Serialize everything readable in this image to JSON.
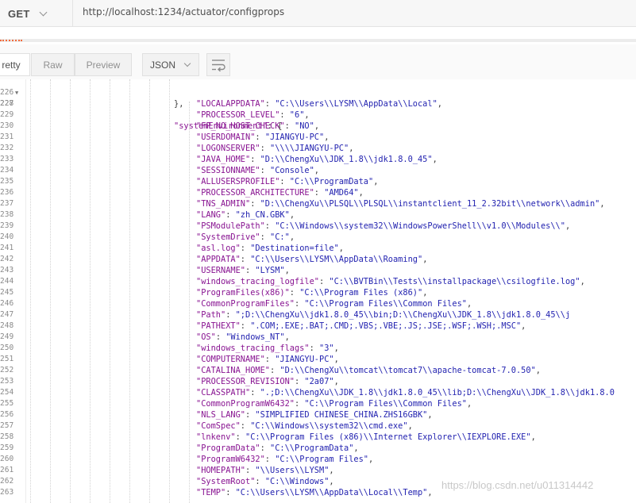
{
  "request": {
    "method": "GET",
    "url": "http://localhost:1234/actuator/configprops"
  },
  "toolbar": {
    "tabs": [
      "retty",
      "Raw",
      "Preview"
    ],
    "format": "JSON",
    "wrap_icon": "wrap-lines-icon"
  },
  "code": {
    "first_line": {
      "number": "226",
      "text": "},"
    },
    "open_line": {
      "number": "227",
      "key": "\"systemEnvironment\"",
      "rest": ": {"
    },
    "entries": [
      {
        "n": "228",
        "key": "\"LOCALAPPDATA\"",
        "value": "\"C:\\\\Users\\\\LYSM\\\\AppData\\\\Local\"",
        "comma": ","
      },
      {
        "n": "229",
        "key": "\"PROCESSOR_LEVEL\"",
        "value": "\"6\"",
        "comma": ","
      },
      {
        "n": "230",
        "key": "\"FP_NO_HOST_CHECK\"",
        "value": "\"NO\"",
        "comma": ","
      },
      {
        "n": "231",
        "key": "\"USERDOMAIN\"",
        "value": "\"JIANGYU-PC\"",
        "comma": ","
      },
      {
        "n": "232",
        "key": "\"LOGONSERVER\"",
        "value": "\"\\\\\\\\JIANGYU-PC\"",
        "comma": ","
      },
      {
        "n": "233",
        "key": "\"JAVA_HOME\"",
        "value": "\"D:\\\\ChengXu\\\\JDK_1.8\\\\jdk1.8.0_45\"",
        "comma": ","
      },
      {
        "n": "234",
        "key": "\"SESSIONNAME\"",
        "value": "\"Console\"",
        "comma": ","
      },
      {
        "n": "235",
        "key": "\"ALLUSERSPROFILE\"",
        "value": "\"C:\\\\ProgramData\"",
        "comma": ","
      },
      {
        "n": "236",
        "key": "\"PROCESSOR_ARCHITECTURE\"",
        "value": "\"AMD64\"",
        "comma": ","
      },
      {
        "n": "237",
        "key": "\"TNS_ADMIN\"",
        "value": "\"D:\\\\ChengXu\\\\PLSQL\\\\PLSQL\\\\instantclient_11_2.32bit\\\\network\\\\admin\"",
        "comma": ","
      },
      {
        "n": "238",
        "key": "\"LANG\"",
        "value": "\"zh_CN.GBK\"",
        "comma": ","
      },
      {
        "n": "239",
        "key": "\"PSModulePath\"",
        "value": "\"C:\\\\Windows\\\\system32\\\\WindowsPowerShell\\\\v1.0\\\\Modules\\\\\"",
        "comma": ","
      },
      {
        "n": "240",
        "key": "\"SystemDrive\"",
        "value": "\"C:\"",
        "comma": ","
      },
      {
        "n": "241",
        "key": "\"asl.log\"",
        "value": "\"Destination=file\"",
        "comma": ","
      },
      {
        "n": "242",
        "key": "\"APPDATA\"",
        "value": "\"C:\\\\Users\\\\LYSM\\\\AppData\\\\Roaming\"",
        "comma": ","
      },
      {
        "n": "243",
        "key": "\"USERNAME\"",
        "value": "\"LYSM\"",
        "comma": ","
      },
      {
        "n": "244",
        "key": "\"windows_tracing_logfile\"",
        "value": "\"C:\\\\BVTBin\\\\Tests\\\\installpackage\\\\csilogfile.log\"",
        "comma": ","
      },
      {
        "n": "245",
        "key": "\"ProgramFiles(x86)\"",
        "value": "\"C:\\\\Program Files (x86)\"",
        "comma": ","
      },
      {
        "n": "246",
        "key": "\"CommonProgramFiles\"",
        "value": "\"C:\\\\Program Files\\\\Common Files\"",
        "comma": ","
      },
      {
        "n": "247",
        "key": "\"Path\"",
        "value": "\";D:\\\\ChengXu\\\\jdk1.8.0_45\\\\bin;D:\\\\ChengXu\\\\JDK_1.8\\\\jdk1.8.0_45\\\\j",
        "comma": ""
      },
      {
        "n": "248",
        "key": "\"PATHEXT\"",
        "value": "\".COM;.EXE;.BAT;.CMD;.VBS;.VBE;.JS;.JSE;.WSF;.WSH;.MSC\"",
        "comma": ","
      },
      {
        "n": "249",
        "key": "\"OS\"",
        "value": "\"Windows_NT\"",
        "comma": ","
      },
      {
        "n": "250",
        "key": "\"windows_tracing_flags\"",
        "value": "\"3\"",
        "comma": ","
      },
      {
        "n": "251",
        "key": "\"COMPUTERNAME\"",
        "value": "\"JIANGYU-PC\"",
        "comma": ","
      },
      {
        "n": "252",
        "key": "\"CATALINA_HOME\"",
        "value": "\"D:\\\\ChengXu\\\\tomcat\\\\tomcat7\\\\apache-tomcat-7.0.50\"",
        "comma": ","
      },
      {
        "n": "253",
        "key": "\"PROCESSOR_REVISION\"",
        "value": "\"2a07\"",
        "comma": ","
      },
      {
        "n": "254",
        "key": "\"CLASSPATH\"",
        "value": "\".;D:\\\\ChengXu\\\\JDK_1.8\\\\jdk1.8.0_45\\\\lib;D:\\\\ChengXu\\\\JDK_1.8\\\\jdk1.8.0",
        "comma": ""
      },
      {
        "n": "255",
        "key": "\"CommonProgramW6432\"",
        "value": "\"C:\\\\Program Files\\\\Common Files\"",
        "comma": ","
      },
      {
        "n": "256",
        "key": "\"NLS_LANG\"",
        "value": "\"SIMPLIFIED CHINESE_CHINA.ZHS16GBK\"",
        "comma": ","
      },
      {
        "n": "257",
        "key": "\"ComSpec\"",
        "value": "\"C:\\\\Windows\\\\system32\\\\cmd.exe\"",
        "comma": ","
      },
      {
        "n": "258",
        "key": "\"lnkenv\"",
        "value": "\"C:\\\\Program Files (x86)\\\\Internet Explorer\\\\IEXPLORE.EXE\"",
        "comma": ","
      },
      {
        "n": "259",
        "key": "\"ProgramData\"",
        "value": "\"C:\\\\ProgramData\"",
        "comma": ","
      },
      {
        "n": "260",
        "key": "\"ProgramW6432\"",
        "value": "\"C:\\\\Program Files\"",
        "comma": ","
      },
      {
        "n": "261",
        "key": "\"HOMEPATH\"",
        "value": "\"\\\\Users\\\\LYSM\"",
        "comma": ","
      },
      {
        "n": "262",
        "key": "\"SystemRoot\"",
        "value": "\"C:\\\\Windows\"",
        "comma": ","
      },
      {
        "n": "263",
        "key": "\"TEMP\"",
        "value": "\"C:\\\\Users\\\\LYSM\\\\AppData\\\\Local\\\\Temp\"",
        "comma": ","
      }
    ]
  },
  "watermark": "https://blog.csdn.net/u011314442",
  "colors": {
    "key": "#881391",
    "string": "#2323b0",
    "accent": "#f26b3a"
  }
}
